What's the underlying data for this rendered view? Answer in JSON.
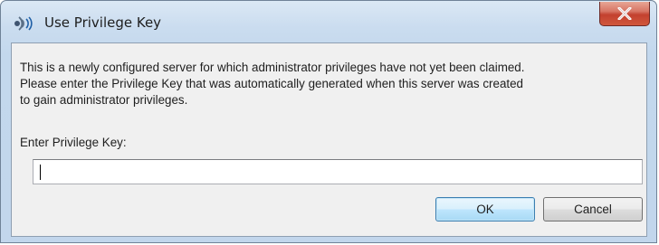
{
  "window": {
    "title": "Use Privilege Key",
    "icon": "teamspeak-icon",
    "close_icon": "close-icon"
  },
  "message": {
    "lines": [
      "This is a newly configured server for which administrator privileges have not yet been claimed.",
      "Please enter the Privilege Key that was automatically generated when this server was created",
      "to gain administrator privileges."
    ]
  },
  "form": {
    "label": "Enter Privilege Key:",
    "value": ""
  },
  "buttons": {
    "ok_label": "OK",
    "cancel_label": "Cancel"
  },
  "colors": {
    "close_button": "#c3412f",
    "default_button_border": "#3c7fb1",
    "frame": "#c2d6ec"
  }
}
